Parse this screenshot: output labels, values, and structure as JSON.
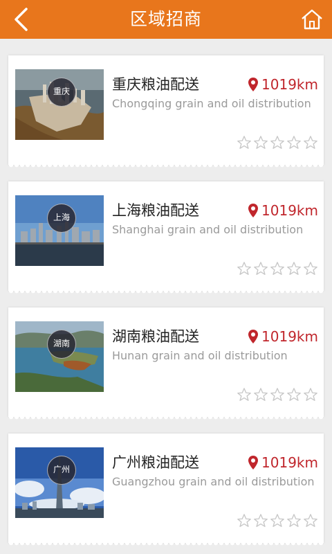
{
  "header": {
    "title": "区域招商",
    "color": "#e8761c"
  },
  "icons": {
    "back": "back-chevron-icon",
    "home": "home-icon",
    "location": "location-pin-icon",
    "star": "star-outline-icon"
  },
  "items": [
    {
      "name": "重庆粮油配送",
      "subtitle": "Chongqing grain and oil distribution",
      "distance": "1019km",
      "badge": "重庆",
      "rating": 0,
      "image": "chongqing-city-image"
    },
    {
      "name": "上海粮油配送",
      "subtitle": "Shanghai grain and oil distribution",
      "distance": "1019km",
      "badge": "上海",
      "rating": 0,
      "image": "shanghai-city-image"
    },
    {
      "name": "湖南粮油配送",
      "subtitle": "Hunan grain and oil distribution",
      "distance": "1019km",
      "badge": "湖南",
      "rating": 0,
      "image": "hunan-landscape-image"
    },
    {
      "name": "广州粮油配送",
      "subtitle": "Guangzhou grain and oil distribution",
      "distance": "1019km",
      "badge": "广州",
      "rating": 0,
      "image": "guangzhou-tower-image"
    }
  ]
}
